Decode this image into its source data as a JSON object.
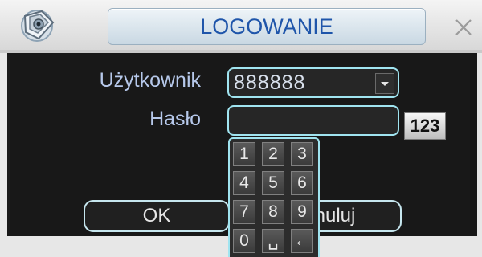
{
  "dialog": {
    "title": "LOGOWANIE"
  },
  "form": {
    "user_label": "Użytkownik",
    "user_value": "888888",
    "password_label": "Hasło",
    "password_value": "",
    "input_mode_label": "123"
  },
  "keypad": {
    "keys": [
      "1",
      "2",
      "3",
      "4",
      "5",
      "6",
      "7",
      "8",
      "9",
      "0",
      "␣",
      "←"
    ]
  },
  "buttons": {
    "ok_label": "OK",
    "cancel_label": "Anuluj"
  },
  "icons": {
    "app_logo": "app-logo-icon",
    "close": "close-icon",
    "dropdown": "chevron-down-icon"
  },
  "colors": {
    "title_text": "#1f55aa",
    "label_text": "#b6c8ea",
    "field_border": "#a0e4f0",
    "panel_bg": "#181818"
  }
}
